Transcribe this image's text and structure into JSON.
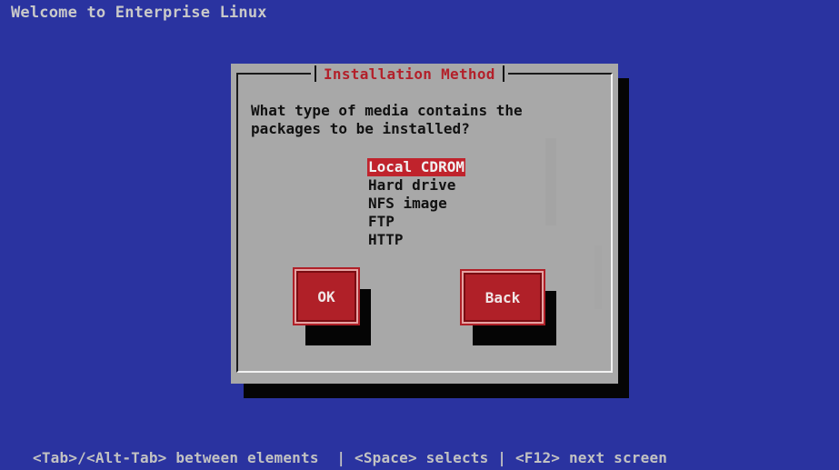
{
  "screen": {
    "welcome_text": "Welcome to Enterprise Linux"
  },
  "dialog": {
    "title": "Installation Method",
    "question_line1": "What type of media contains the",
    "question_line2": "packages to be installed?",
    "items": [
      {
        "label": "Local CDROM",
        "selected": true
      },
      {
        "label": "Hard drive",
        "selected": false
      },
      {
        "label": "NFS image",
        "selected": false
      },
      {
        "label": "FTP",
        "selected": false
      },
      {
        "label": "HTTP",
        "selected": false
      }
    ],
    "ok_label": "OK",
    "back_label": "Back"
  },
  "status_bar": {
    "text": "<Tab>/<Alt-Tab> between elements  | <Space> selects | <F12> next screen"
  },
  "colors": {
    "background": "#2a33a0",
    "dialog": "#a8a8a8",
    "accent_red": "#b02028",
    "shadow": "#050505"
  }
}
